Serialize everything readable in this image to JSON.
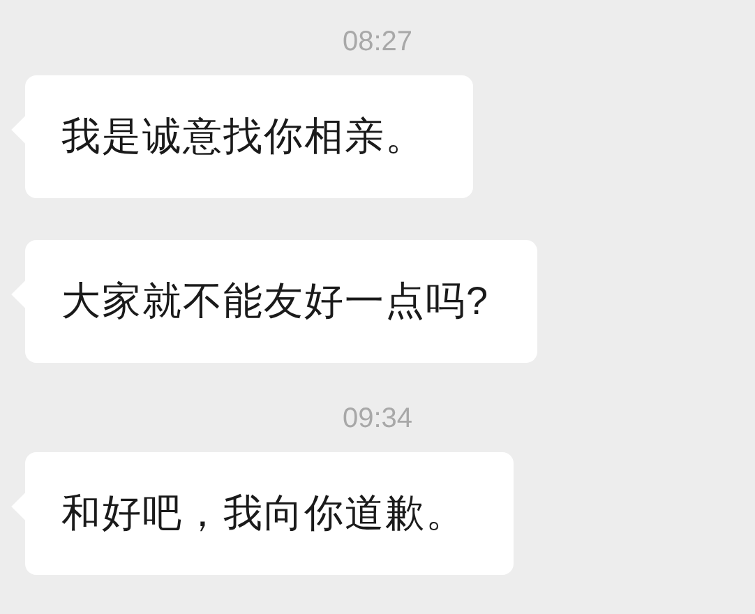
{
  "messages": [
    {
      "kind": "time",
      "text": "08:27"
    },
    {
      "kind": "bubble",
      "text": "我是诚意找你相亲。"
    },
    {
      "kind": "bubble",
      "text": "大家就不能友好一点吗?"
    },
    {
      "kind": "time",
      "text": "09:34"
    },
    {
      "kind": "bubble",
      "text": "和好吧，我向你道歉。"
    }
  ]
}
